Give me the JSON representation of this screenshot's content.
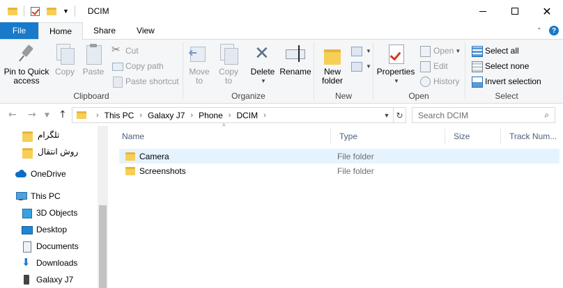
{
  "window": {
    "title": "DCIM",
    "minimize_glyph": "",
    "close_glyph": "✕"
  },
  "ribbon_tabs": {
    "file": "File",
    "home": "Home",
    "share": "Share",
    "view": "View",
    "collapse_glyph": "⌃",
    "help_glyph": "?"
  },
  "ribbon": {
    "clipboard": {
      "label": "Clipboard",
      "pin_line1": "Pin to Quick",
      "pin_line2": "access",
      "copy": "Copy",
      "paste": "Paste",
      "cut": "Cut",
      "copy_path": "Copy path",
      "paste_shortcut": "Paste shortcut"
    },
    "organize": {
      "label": "Organize",
      "move_to_line1": "Move",
      "move_to_line2": "to",
      "copy_to_line1": "Copy",
      "copy_to_line2": "to",
      "delete": "Delete",
      "rename": "Rename"
    },
    "new": {
      "label": "New",
      "new_folder_line1": "New",
      "new_folder_line2": "folder"
    },
    "open": {
      "label": "Open",
      "properties": "Properties",
      "open": "Open",
      "edit": "Edit",
      "history": "History"
    },
    "select": {
      "label": "Select",
      "select_all": "Select all",
      "select_none": "Select none",
      "invert_selection": "Invert selection"
    }
  },
  "address": {
    "breadcrumbs": [
      "This PC",
      "Galaxy J7",
      "Phone",
      "DCIM"
    ],
    "search_placeholder": "Search DCIM"
  },
  "nav_pane": {
    "items": [
      {
        "label": "تلگرام",
        "icon": "folder-icon"
      },
      {
        "label": "روش انتقال",
        "icon": "folder-icon"
      },
      {
        "label": "OneDrive",
        "icon": "onedrive-icon"
      },
      {
        "label": "This PC",
        "icon": "this-pc-icon"
      },
      {
        "label": "3D Objects",
        "icon": "3d-objects-icon"
      },
      {
        "label": "Desktop",
        "icon": "desktop-icon"
      },
      {
        "label": "Documents",
        "icon": "documents-icon"
      },
      {
        "label": "Downloads",
        "icon": "downloads-icon"
      },
      {
        "label": "Galaxy J7",
        "icon": "phone-icon"
      }
    ]
  },
  "file_list": {
    "columns": {
      "name": "Name",
      "type": "Type",
      "size": "Size",
      "track": "Track Num..."
    },
    "rows": [
      {
        "name": "Camera",
        "type": "File folder",
        "selected": true
      },
      {
        "name": "Screenshots",
        "type": "File folder",
        "selected": false
      }
    ]
  },
  "colors": {
    "file_tab": "#1979ca",
    "ribbon_bg": "#f5f6f7",
    "folder": "#f6cf57",
    "selected_row": "#e5f3ff"
  }
}
